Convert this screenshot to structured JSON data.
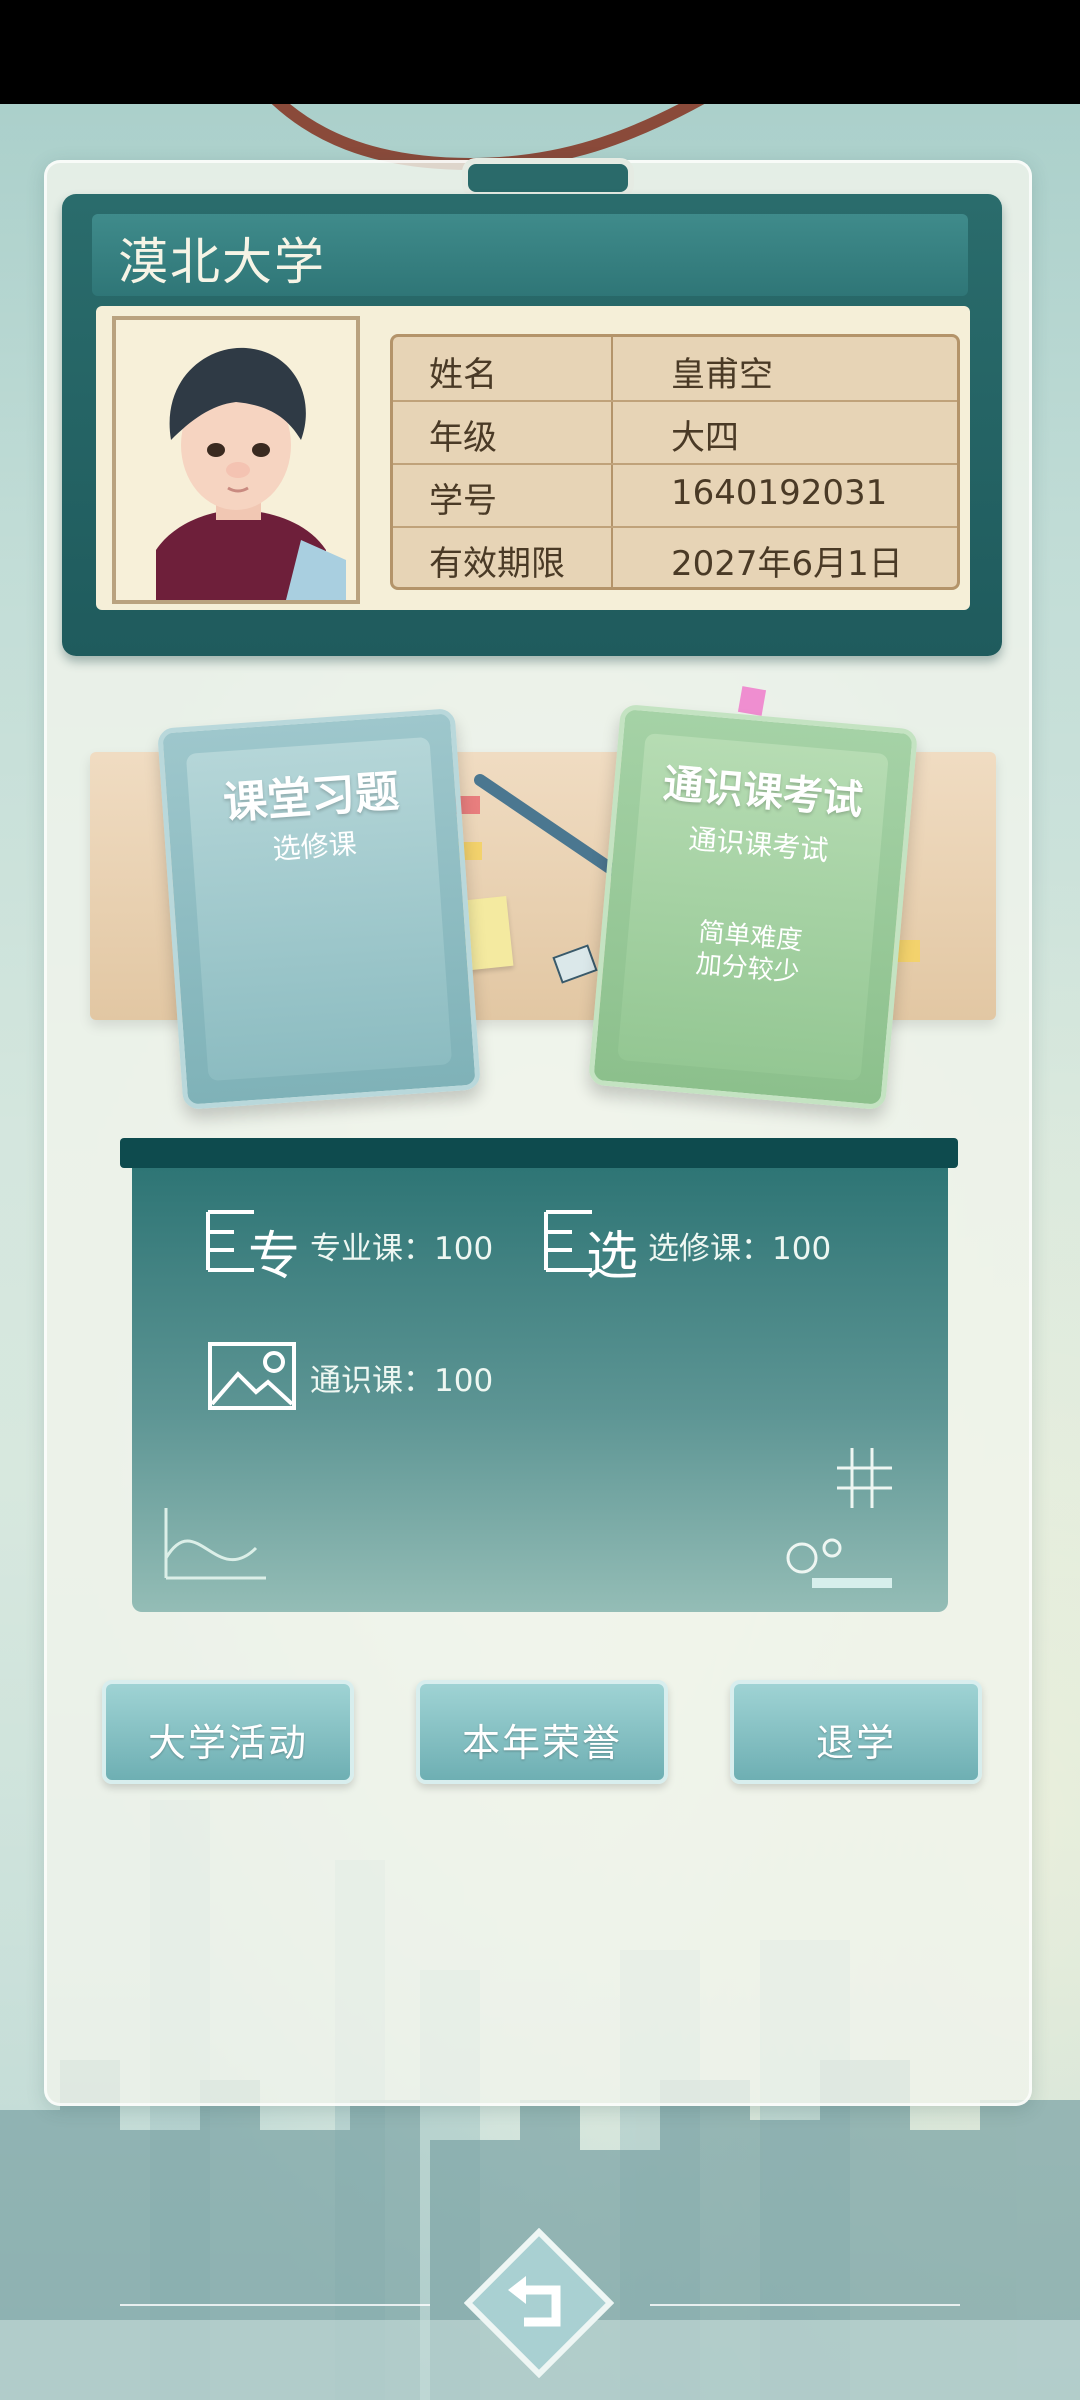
{
  "id_card": {
    "university": "漠北大学",
    "rows": [
      {
        "label": "姓名",
        "value": "皇甫空"
      },
      {
        "label": "年级",
        "value": "大四"
      },
      {
        "label": "学号",
        "value": "1640192031"
      },
      {
        "label": "有效期限",
        "value": "2027年6月1日"
      }
    ]
  },
  "books": {
    "classroom": {
      "title": "课堂习题",
      "subtitle": "选修课"
    },
    "general": {
      "title": "通识课考试",
      "subtitle": "通识课考试",
      "desc_line1": "简单难度",
      "desc_line2": "加分较少"
    }
  },
  "board": {
    "major": {
      "label": "专业课：100",
      "icon_glyph": "专"
    },
    "elective": {
      "label": "选修课：100",
      "icon_glyph": "选"
    },
    "general": {
      "label": "通识课：100"
    }
  },
  "buttons": {
    "activities": "大学活动",
    "honors": "本年荣誉",
    "dropout": "退学"
  },
  "icons": {
    "back": "back-arrow-icon"
  }
}
